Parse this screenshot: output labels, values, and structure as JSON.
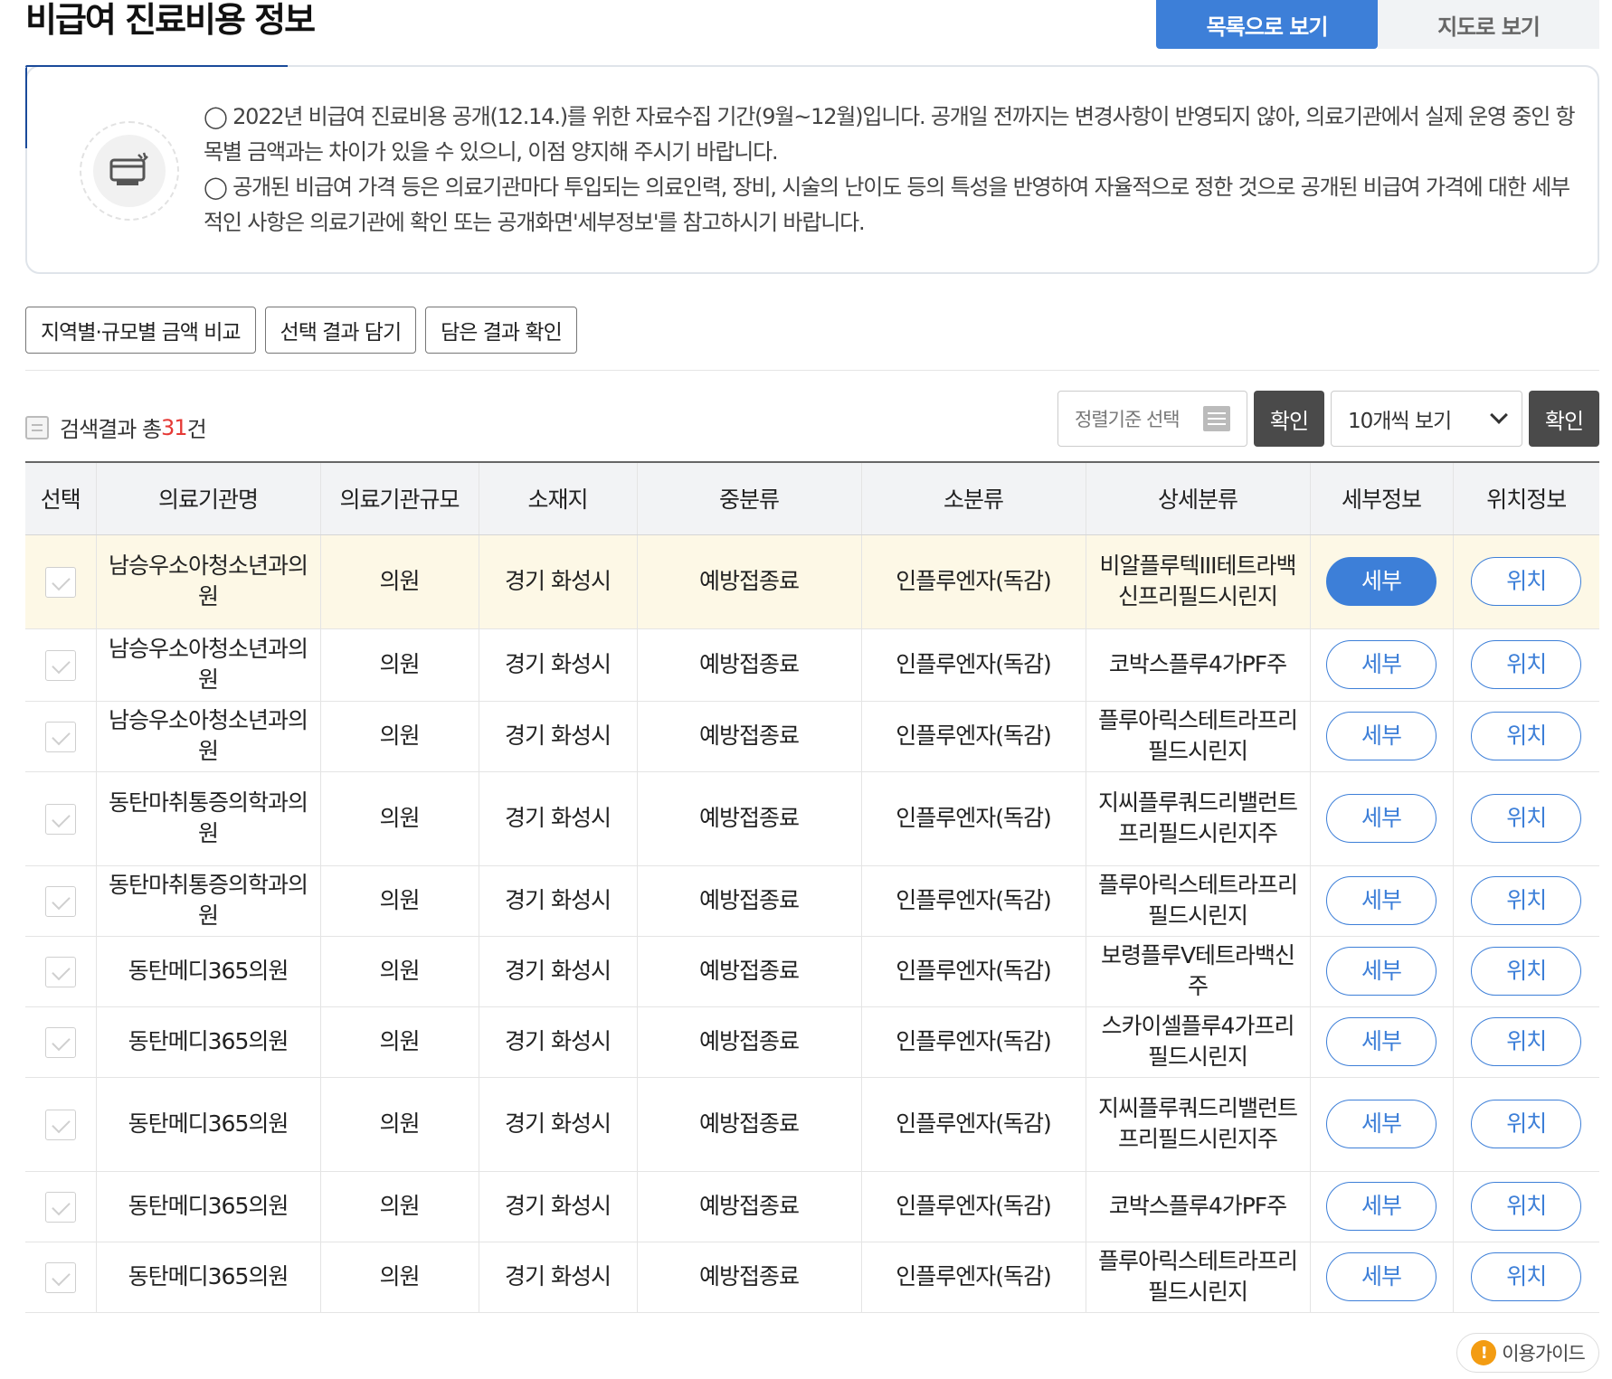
{
  "header": {
    "title": "비급여 진료비용 정보",
    "tab_list": "목록으로 보기",
    "tab_map": "지도로 보기"
  },
  "notice": {
    "line1": "◯ 2022년 비급여 진료비용 공개(12.14.)를 위한 자료수집 기간(9월~12월)입니다. 공개일 전까지는 변경사항이 반영되지 않아, 의료기관에서 실제 운영 중인 항목별 금액과는 차이가 있을 수 있으니, 이점 양지해 주시기 바랍니다.",
    "line2": "◯ 공개된 비급여 가격 등은 의료기관마다 투입되는 의료인력, 장비, 시술의 난이도 등의 특성을 반영하여 자율적으로 정한 것으로 공개된 비급여 가격에 대한 세부적인 사항은 의료기관에 확인 또는 공개화면'세부정보'를 참고하시기 바랍니다."
  },
  "actions": {
    "compare": "지역별·규모별 금액 비교",
    "add_selected": "선택 결과 담기",
    "view_saved": "담은 결과 확인"
  },
  "summary": {
    "prefix": "검색결과 총",
    "count": "31",
    "suffix": "건"
  },
  "controls": {
    "sort_placeholder": "정렬기준 선택",
    "confirm": "확인",
    "page_size": "10개씩 보기"
  },
  "table": {
    "headers": [
      "선택",
      "의료기관명",
      "의료기관규모",
      "소재지",
      "중분류",
      "소분류",
      "상세분류",
      "세부정보",
      "위치정보"
    ],
    "detail_label": "세부",
    "location_label": "위치",
    "rows": [
      {
        "name": "남승우소아청소년과의원",
        "size": "의원",
        "location": "경기 화성시",
        "mid": "예방접종료",
        "sub": "인플루엔자(독감)",
        "detail": "비알플루텍III테트라백신프리필드시린지"
      },
      {
        "name": "남승우소아청소년과의원",
        "size": "의원",
        "location": "경기 화성시",
        "mid": "예방접종료",
        "sub": "인플루엔자(독감)",
        "detail": "코박스플루4가PF주"
      },
      {
        "name": "남승우소아청소년과의원",
        "size": "의원",
        "location": "경기 화성시",
        "mid": "예방접종료",
        "sub": "인플루엔자(독감)",
        "detail": "플루아릭스테트라프리필드시린지"
      },
      {
        "name": "동탄마취통증의학과의원",
        "size": "의원",
        "location": "경기 화성시",
        "mid": "예방접종료",
        "sub": "인플루엔자(독감)",
        "detail": "지씨플루쿼드리밸런트프리필드시린지주"
      },
      {
        "name": "동탄마취통증의학과의원",
        "size": "의원",
        "location": "경기 화성시",
        "mid": "예방접종료",
        "sub": "인플루엔자(독감)",
        "detail": "플루아릭스테트라프리필드시린지"
      },
      {
        "name": "동탄메디365의원",
        "size": "의원",
        "location": "경기 화성시",
        "mid": "예방접종료",
        "sub": "인플루엔자(독감)",
        "detail": "보령플루Ⅴ테트라백신주"
      },
      {
        "name": "동탄메디365의원",
        "size": "의원",
        "location": "경기 화성시",
        "mid": "예방접종료",
        "sub": "인플루엔자(독감)",
        "detail": "스카이셀플루4가프리필드시린지"
      },
      {
        "name": "동탄메디365의원",
        "size": "의원",
        "location": "경기 화성시",
        "mid": "예방접종료",
        "sub": "인플루엔자(독감)",
        "detail": "지씨플루쿼드리밸런트프리필드시린지주"
      },
      {
        "name": "동탄메디365의원",
        "size": "의원",
        "location": "경기 화성시",
        "mid": "예방접종료",
        "sub": "인플루엔자(독감)",
        "detail": "코박스플루4가PF주"
      },
      {
        "name": "동탄메디365의원",
        "size": "의원",
        "location": "경기 화성시",
        "mid": "예방접종료",
        "sub": "인플루엔자(독감)",
        "detail": "플루아릭스테트라프리필드시린지"
      }
    ]
  },
  "guide": {
    "label": "이용가이드"
  }
}
